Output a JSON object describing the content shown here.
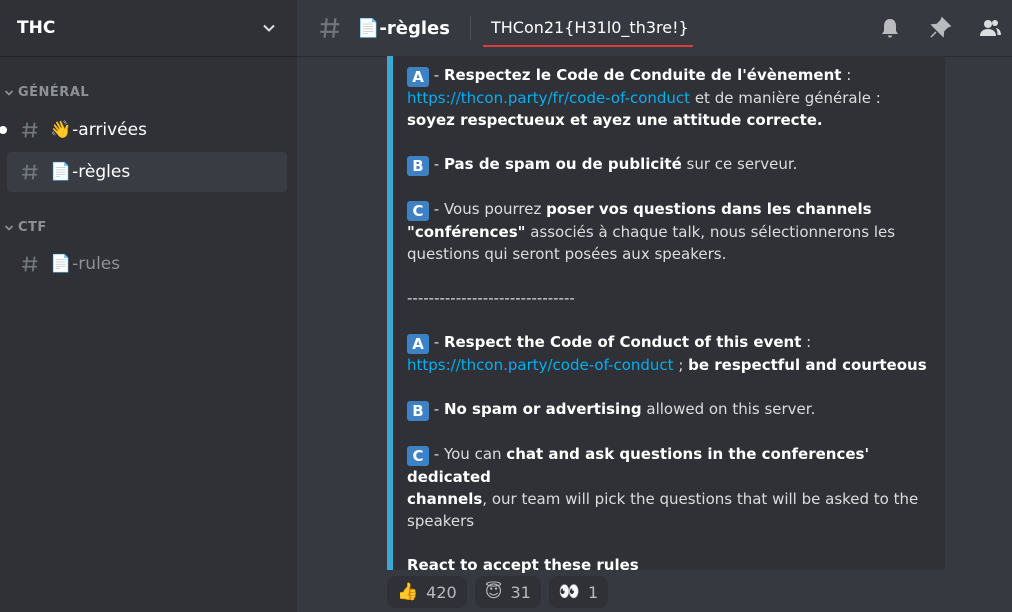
{
  "server": {
    "name": "THC"
  },
  "sidebar": {
    "categories": [
      {
        "name": "GÉNÉRAL"
      },
      {
        "name": "CTF"
      }
    ],
    "channels": [
      {
        "emoji": "👋",
        "label": "-arrivées"
      },
      {
        "emoji": "📄",
        "label": "-règles"
      },
      {
        "emoji": "📄",
        "label": "-rules"
      }
    ]
  },
  "topbar": {
    "channel_emoji": "📄",
    "channel_name": "-règles",
    "topic": "THCon21{H31l0_th3re!}"
  },
  "embed": {
    "fr": {
      "a_letter": "A",
      "a_bold": "Respectez le Code de Conduite de l'évènement",
      "a_colon": " :",
      "a_link": "https://thcon.party/fr/code-of-conduct",
      "a_tail": " et de manière générale :",
      "a_bold2": "soyez respectueux et ayez une attitude correcte.",
      "b_letter": "B",
      "b_bold": "Pas de spam ou de publicité",
      "b_tail": " sur ce serveur.",
      "c_letter": "C",
      "c_pre": " - Vous pourrez ",
      "c_bold": "poser vos questions dans les channels",
      "c_bold2": "\"conférences\"",
      "c_tail": " associés à chaque talk, nous sélectionnerons les",
      "c_tail2": "questions qui seront posées aux speakers."
    },
    "separator": "-------------------------------",
    "en": {
      "a_letter": "A",
      "a_bold": "Respect the Code of Conduct of this event",
      "a_colon": " :",
      "a_link": "https://thcon.party/code-of-conduct",
      "a_sep": " ; ",
      "a_bold2": "be respectful and courteous",
      "b_letter": "B",
      "b_bold": "No spam or advertising",
      "b_tail": " allowed on this server.",
      "c_letter": "C",
      "c_pre": " - You can ",
      "c_bold": "chat and ask questions in the conferences' dedicated",
      "c_bold2": "channels",
      "c_tail": ", our team will pick the questions that will be asked to the",
      "c_tail2": "speakers"
    },
    "react_line": "React to accept these rules"
  },
  "reactions": [
    {
      "emoji": "👍",
      "count": "420"
    },
    {
      "emoji": "😇",
      "count": "31"
    },
    {
      "emoji": "👀",
      "count": "1"
    }
  ]
}
